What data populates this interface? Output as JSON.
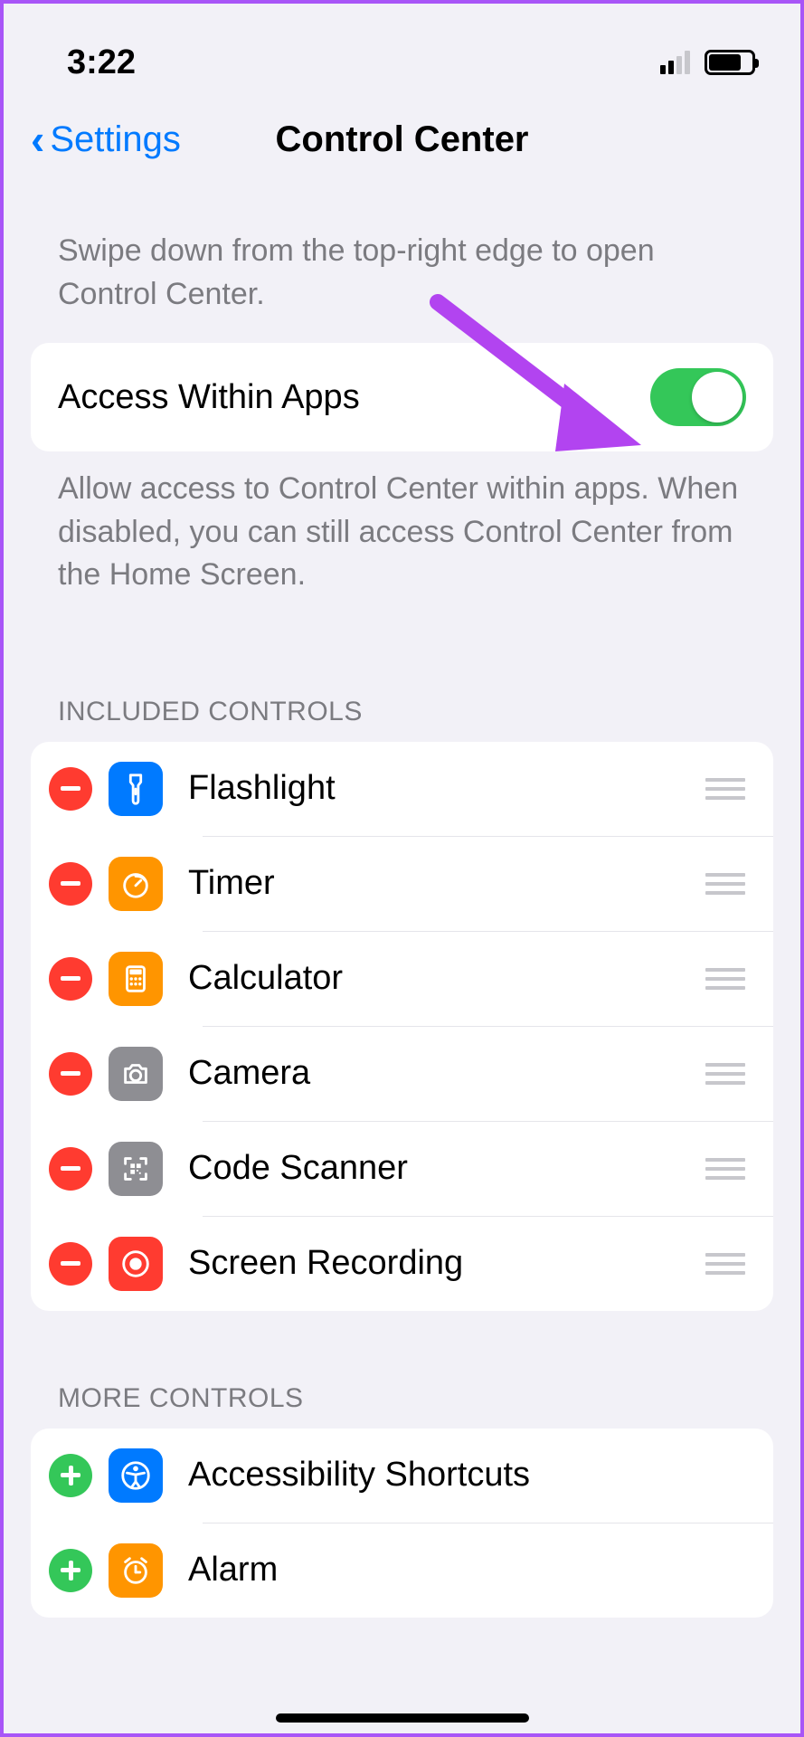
{
  "status": {
    "time": "3:22",
    "cellular_bars_active": 2,
    "battery_level_pct": 70
  },
  "nav": {
    "back_label": "Settings",
    "title": "Control Center"
  },
  "intro_desc": "Swipe down from the top-right edge to open Control Center.",
  "access_toggle": {
    "label": "Access Within Apps",
    "on": true,
    "footer": "Allow access to Control Center within apps. When disabled, you can still access Control Center from the Home Screen."
  },
  "included": {
    "header": "INCLUDED CONTROLS",
    "items": [
      {
        "label": "Flashlight",
        "icon": "flashlight-icon",
        "icon_color": "ic-blue"
      },
      {
        "label": "Timer",
        "icon": "timer-icon",
        "icon_color": "ic-orange"
      },
      {
        "label": "Calculator",
        "icon": "calculator-icon",
        "icon_color": "ic-orange"
      },
      {
        "label": "Camera",
        "icon": "camera-icon",
        "icon_color": "ic-gray"
      },
      {
        "label": "Code Scanner",
        "icon": "qr-icon",
        "icon_color": "ic-gray"
      },
      {
        "label": "Screen Recording",
        "icon": "record-icon",
        "icon_color": "ic-red"
      }
    ]
  },
  "more": {
    "header": "MORE CONTROLS",
    "items": [
      {
        "label": "Accessibility Shortcuts",
        "icon": "accessibility-icon",
        "icon_color": "ic-blue"
      },
      {
        "label": "Alarm",
        "icon": "alarm-icon",
        "icon_color": "ic-orange"
      }
    ]
  },
  "annotation": {
    "arrow_color": "#b244f0"
  }
}
